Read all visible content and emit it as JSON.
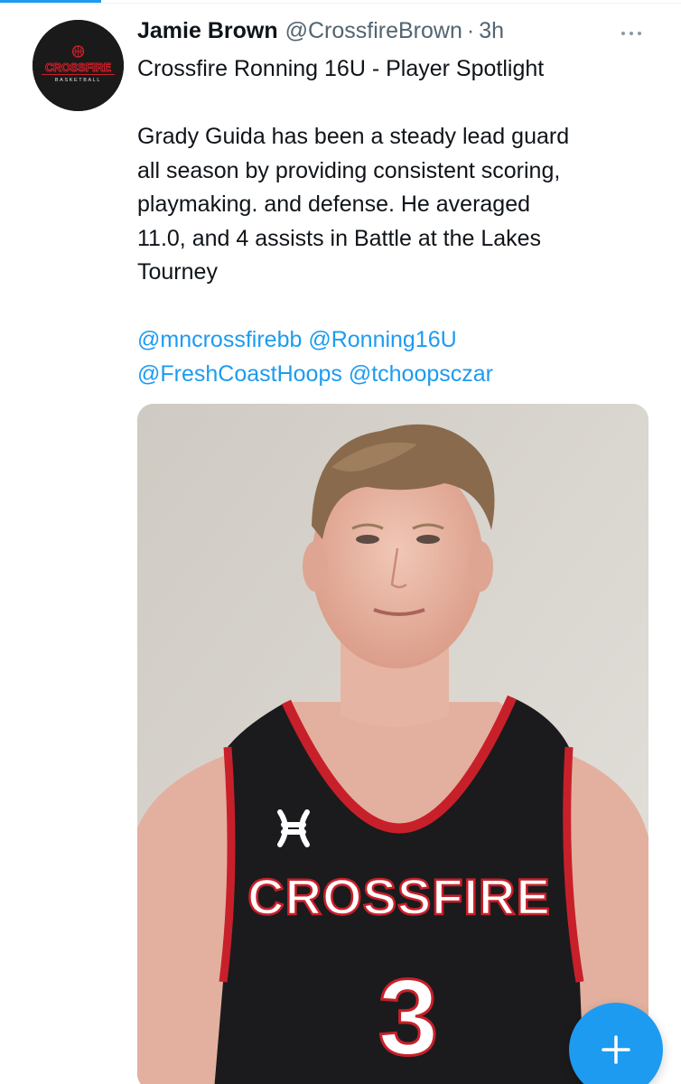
{
  "tweet": {
    "display_name": "Jamie Brown",
    "handle": "@CrossfireBrown",
    "separator": "·",
    "time": "3h",
    "line1": "Crossfire Ronning 16U - Player Spotlight",
    "body_lines": [
      "Grady Guida has been a steady lead guard",
      "all season by providing consistent scoring,",
      "playmaking. and defense. He averaged",
      "11.0, and 4 assists in Battle at the Lakes",
      "Tourney"
    ],
    "mentions_line1": [
      "@mncrossfirebb",
      "@Ronning16U"
    ],
    "mentions_line2": [
      "@FreshCoastHoops",
      "@tchoopsczar"
    ]
  },
  "avatar": {
    "logo_top": "CROSSFIRE",
    "logo_bottom": "BASKETBALL"
  },
  "photo": {
    "jersey_text": "CROSSFIRE",
    "jersey_number": "3"
  },
  "icons": {
    "more": "more-horizontal-icon",
    "compose": "plus-icon"
  },
  "colors": {
    "accent": "#1d9bf0",
    "text": "#0f1419",
    "secondary": "#536471"
  }
}
